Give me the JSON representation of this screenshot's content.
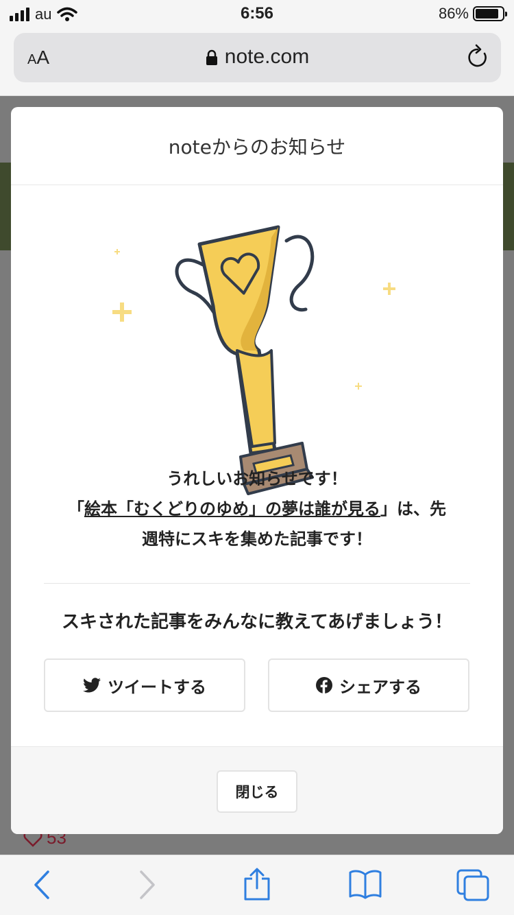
{
  "status_bar": {
    "carrier": "au",
    "time": "6:56",
    "battery": "86%"
  },
  "browser": {
    "text_size_label_small": "A",
    "text_size_label_large": "A",
    "url": "note.com"
  },
  "background_page": {
    "like_count": "53"
  },
  "modal": {
    "title": "noteからのお知らせ",
    "message_line1": "うれしいお知らせです！",
    "article_title": "絵本「むくどりのゆめ」の夢は誰が見る",
    "message_line2_pre": "「",
    "message_line2_post": "」は、先",
    "message_line3": "週特にスキを集めた記事です！",
    "share_prompt": "スキされた記事をみんなに教えてあげましょう！",
    "tweet_label": "ツイートする",
    "facebook_label": "シェアする",
    "close_label": "閉じる"
  },
  "colors": {
    "trophy_gold": "#f5cd57",
    "trophy_outline": "#323c4b",
    "sparkle": "#f7dc82",
    "browser_blue": "#2f7fe0"
  },
  "icons": {
    "trophy": "trophy-icon",
    "twitter": "twitter-icon",
    "facebook": "facebook-icon"
  }
}
